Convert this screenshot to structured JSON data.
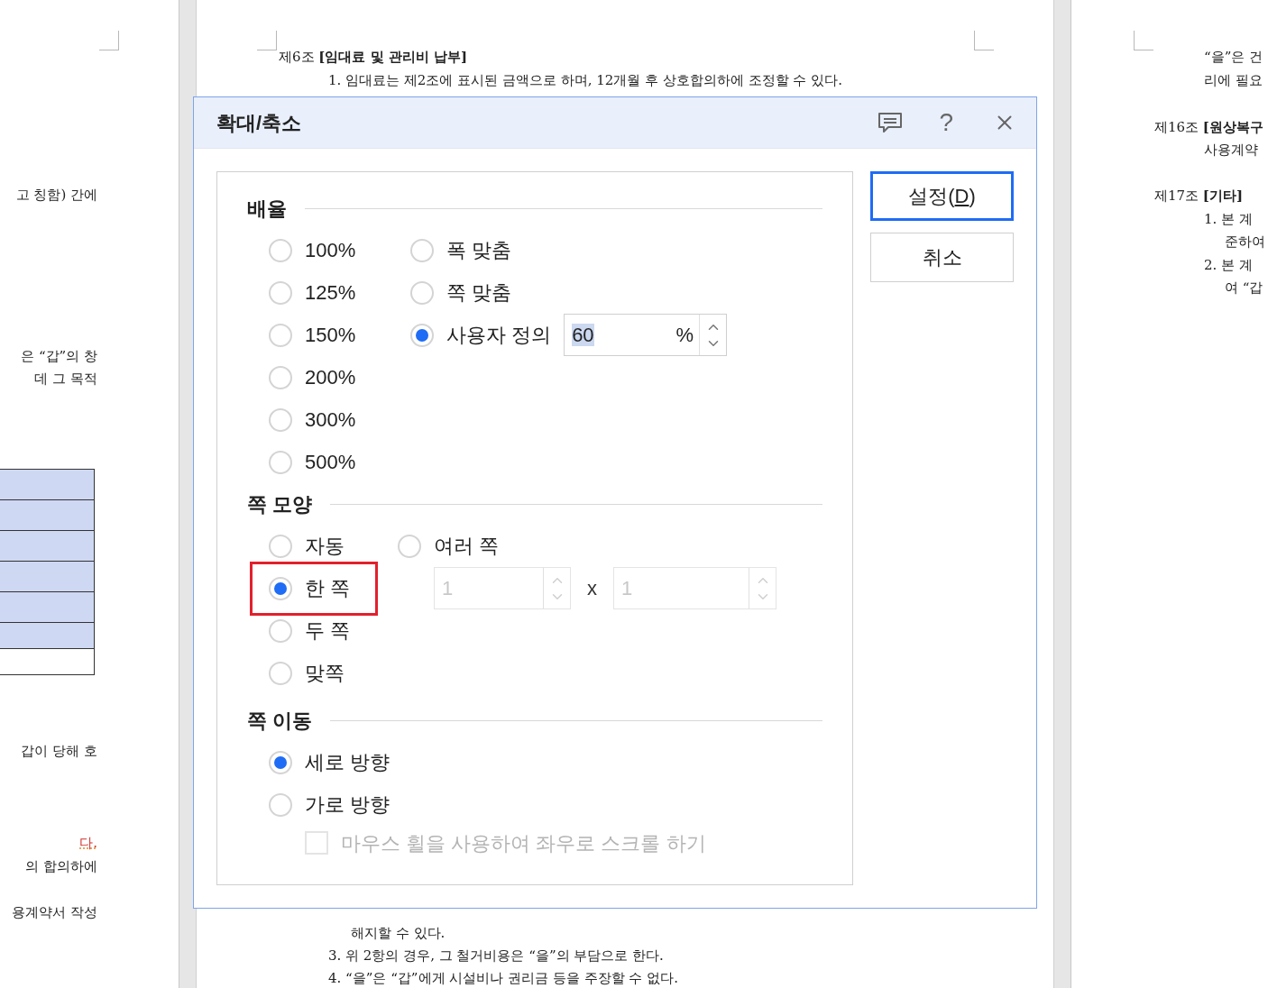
{
  "document": {
    "left_page": {
      "lines": [
        {
          "text": "고 칭함) 간에"
        },
        {
          "text": "은 “갑”의 창"
        },
        {
          "text": "데 그 목적"
        },
        {
          "text": "갑이 당해 호"
        },
        {
          "text": "다.",
          "color": "#d0312d"
        },
        {
          "text": "의 합의하에"
        },
        {
          "text": "용계약서 작성"
        }
      ],
      "table_rows": [
        {
          "shaded": true
        },
        {
          "shaded": true
        },
        {
          "shaded": true
        },
        {
          "shaded": true
        },
        {
          "shaded": true
        },
        {
          "shaded": true
        },
        {
          "shaded": false
        }
      ]
    },
    "center_page": {
      "top_lines": [
        "제6조 **[임대료 및 관리비 납부]**",
        "1. 임대료는 제2조에 표시된 금액으로 하며, 12개월 후 상호합의하에 조정할 수 있다."
      ],
      "bottom_lines": [
        "해지할 수 있다.",
        "3. 위 2항의 경우, 그 철거비용은 “을”의 부담으로 한다.",
        "4. “을”은 “갑”에게 시설비나 권리금 등을 주장할 수 없다."
      ]
    },
    "right_page": {
      "lines": [
        "“을”은 건",
        "리에 필요",
        "제16조 **[원상복구**",
        "사용계약",
        "제17조 **[기타]**",
        "1. 본 계",
        "준하여",
        "2. 본 계",
        "여 “갑"
      ]
    }
  },
  "dialog": {
    "title": "확대/축소",
    "help": "?",
    "ok": {
      "before": "설정(",
      "key": "D",
      "after": ")"
    },
    "cancel": "취소",
    "zoom": {
      "heading": "배율",
      "presets": [
        {
          "label": "100%",
          "selected": false
        },
        {
          "label": "125%",
          "selected": false
        },
        {
          "label": "150%",
          "selected": false
        },
        {
          "label": "200%",
          "selected": false
        },
        {
          "label": "300%",
          "selected": false
        },
        {
          "label": "500%",
          "selected": false
        }
      ],
      "fits": [
        {
          "label": "폭 맞춤",
          "selected": false
        },
        {
          "label": "쪽 맞춤",
          "selected": false
        }
      ],
      "custom": {
        "label": "사용자 정의",
        "selected": true,
        "value": "60",
        "unit": "%"
      }
    },
    "page_shape": {
      "heading": "쪽 모양",
      "options": [
        {
          "label": "자동",
          "selected": false,
          "highlighted": false
        },
        {
          "label": "한 쪽",
          "selected": true,
          "highlighted": true
        },
        {
          "label": "두 쪽",
          "selected": false,
          "highlighted": false
        },
        {
          "label": "맞쪽",
          "selected": false,
          "highlighted": false
        }
      ],
      "multi": {
        "label": "여러 쪽",
        "selected": false,
        "cols": "1",
        "times": "x",
        "rows": "1",
        "disabled": true
      }
    },
    "page_move": {
      "heading": "쪽 이동",
      "options": [
        {
          "label": "세로 방향",
          "selected": true
        },
        {
          "label": "가로 방향",
          "selected": false
        }
      ],
      "wheel": {
        "label": "마우스 휠을 사용하여 좌우로 스크롤 하기",
        "checked": false,
        "disabled": true
      }
    }
  }
}
